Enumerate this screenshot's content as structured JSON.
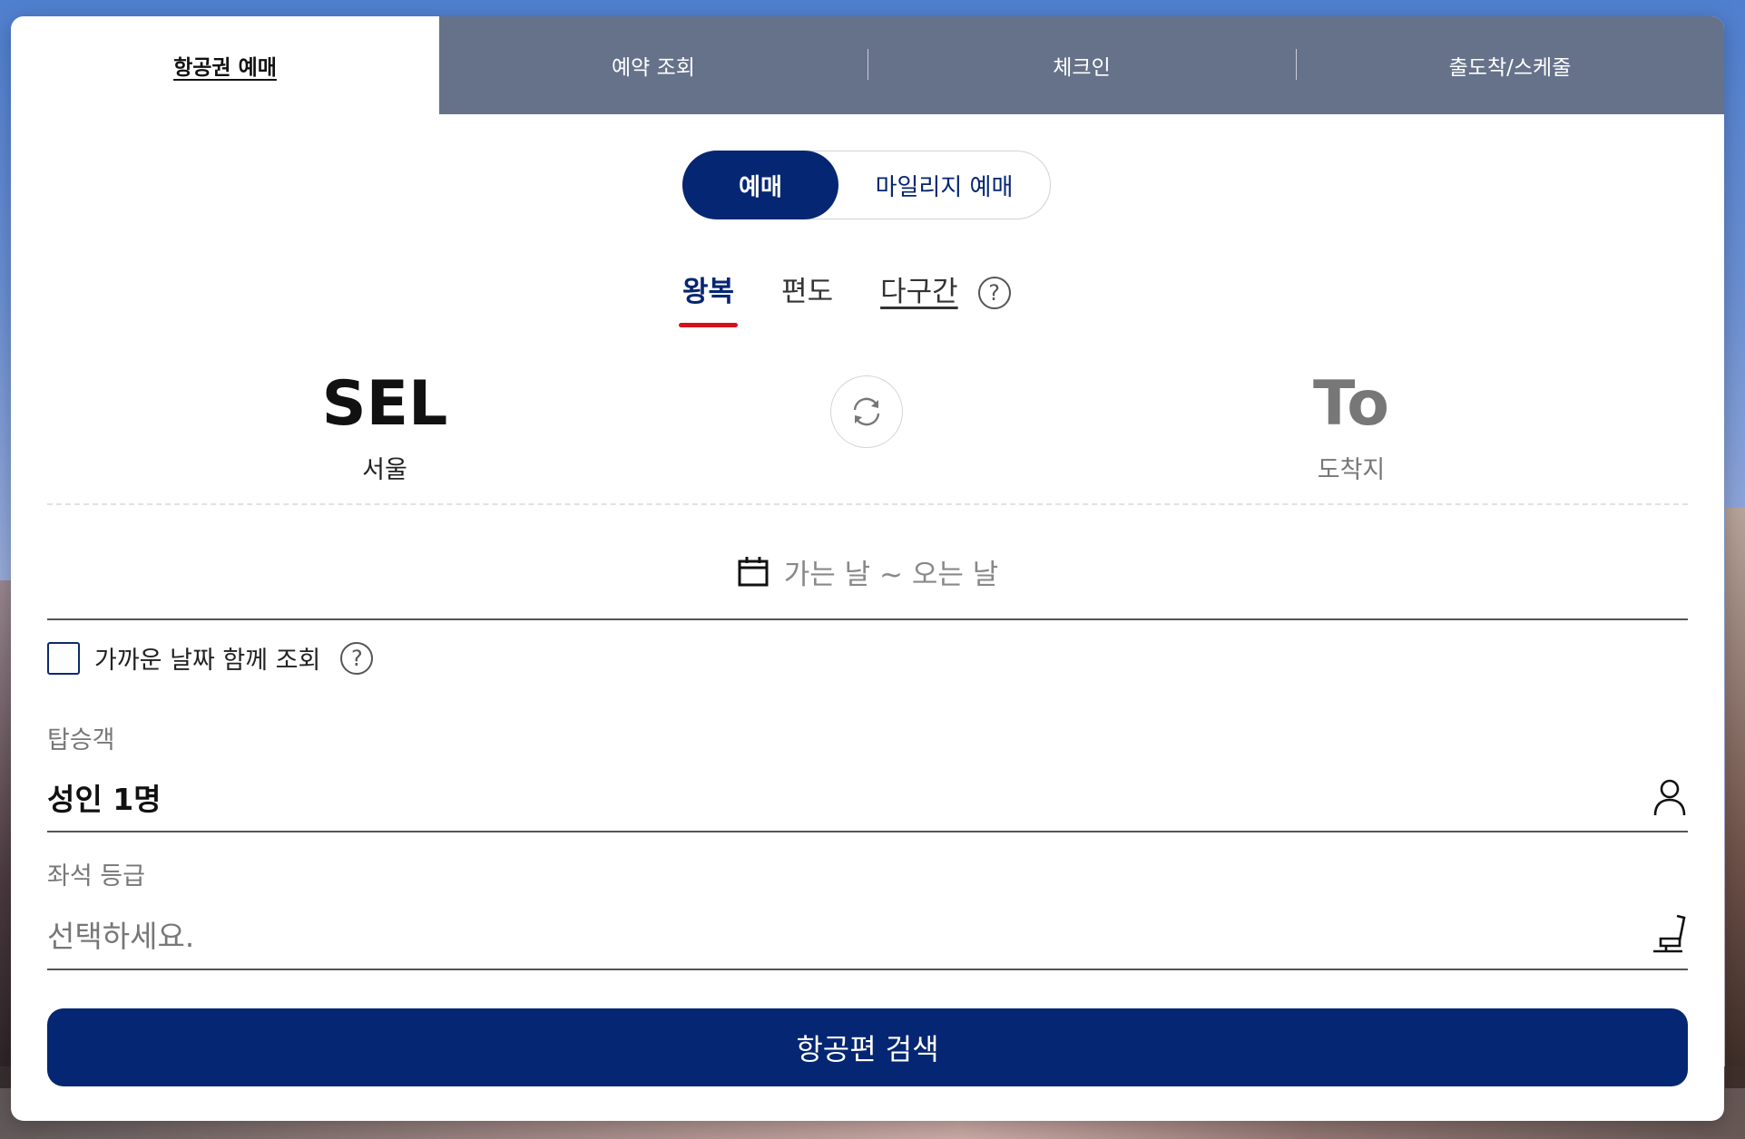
{
  "tabs": [
    {
      "label": "항공권 예매",
      "active": true
    },
    {
      "label": "예약 조회",
      "active": false
    },
    {
      "label": "체크인",
      "active": false
    },
    {
      "label": "출도착/스케줄",
      "active": false
    }
  ],
  "booking_type": {
    "regular": "예매",
    "mileage": "마일리지 예매"
  },
  "trip_types": {
    "round_trip": "왕복",
    "one_way": "편도",
    "multi_city": "다구간",
    "help": "?"
  },
  "route": {
    "from_code": "SEL",
    "from_name": "서울",
    "to_code": "To",
    "to_name": "도착지"
  },
  "date": {
    "placeholder": "가는 날 ~ 오는 날"
  },
  "flexible": {
    "label": "가까운 날짜 함께 조회",
    "help": "?"
  },
  "passengers": {
    "label": "탑승객",
    "value": "성인 1명"
  },
  "seat_class": {
    "label": "좌석 등급",
    "placeholder": "선택하세요."
  },
  "search_button": "항공편 검색",
  "colors": {
    "primary": "#052672",
    "accent_red": "#d7111b",
    "tab_bar": "#66728a"
  }
}
